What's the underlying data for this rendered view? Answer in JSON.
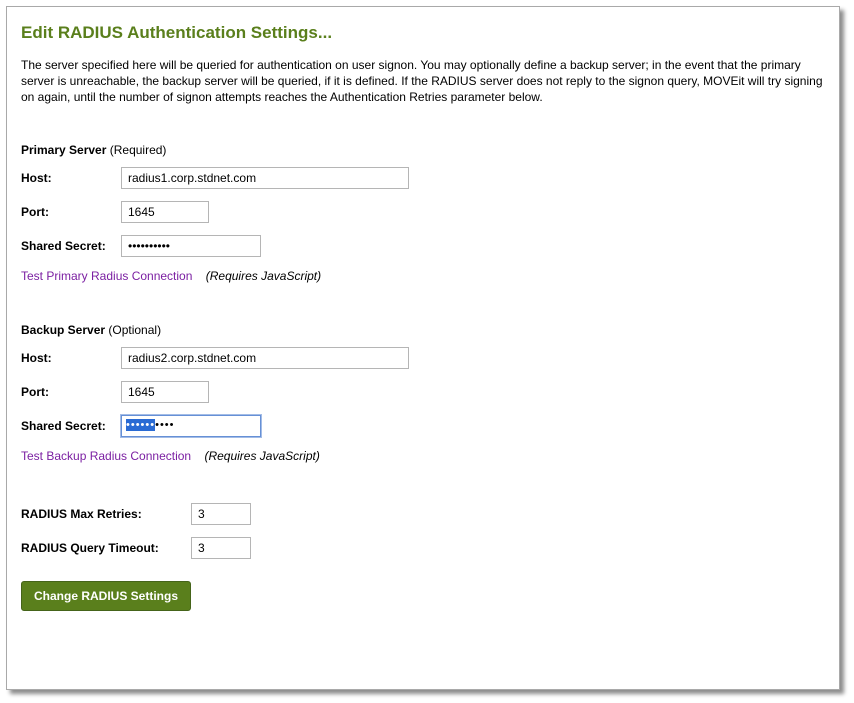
{
  "title": "Edit RADIUS Authentication Settings...",
  "description": "The server specified here will be queried for authentication on user signon. You may optionally define a backup server; in the event that the primary server is unreachable, the backup server will be queried, if it is defined. If the RADIUS server does not reply to the signon query, MOVEit will try signing on again, until the number of signon attempts reaches the Authentication Retries parameter below.",
  "primary": {
    "header_name": "Primary Server",
    "header_note": " (Required)",
    "host_label": "Host:",
    "host_value": "radius1.corp.stdnet.com",
    "port_label": "Port:",
    "port_value": "1645",
    "secret_label": "Shared Secret:",
    "secret_value": "••••••••••",
    "test_link": "Test Primary Radius Connection",
    "requires_js": "(Requires JavaScript)"
  },
  "backup": {
    "header_name": "Backup Server",
    "header_note": " (Optional)",
    "host_label": "Host:",
    "host_value": "radius2.corp.stdnet.com",
    "port_label": "Port:",
    "port_value": "1645",
    "secret_label": "Shared Secret:",
    "secret_value_selected": "••••••",
    "secret_value_rest": "••••",
    "test_link": "Test Backup Radius Connection",
    "requires_js": "(Requires JavaScript)"
  },
  "retries": {
    "max_label": "RADIUS Max Retries:",
    "max_value": "3",
    "timeout_label": "RADIUS Query Timeout:",
    "timeout_value": "3"
  },
  "submit_label": "Change RADIUS Settings"
}
